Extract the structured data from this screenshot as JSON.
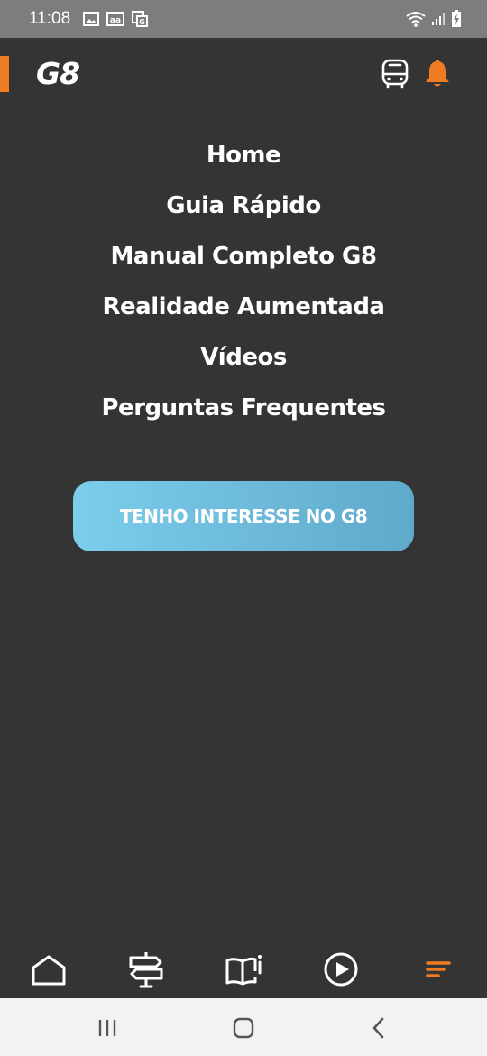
{
  "status_bar": {
    "time": "11:08",
    "left_icons": [
      "image-icon",
      "text-recognition-icon",
      "translate-icon"
    ],
    "right_icons": [
      "wifi-icon",
      "signal-icon",
      "battery-charging-icon"
    ]
  },
  "header": {
    "logo_text": "G8",
    "icons": [
      "bus-icon",
      "bell-icon"
    ]
  },
  "menu": {
    "items": [
      {
        "label": "Home"
      },
      {
        "label": "Guia Rápido"
      },
      {
        "label": "Manual Completo G8"
      },
      {
        "label": "Realidade Aumentada"
      },
      {
        "label": "Vídeos"
      },
      {
        "label": "Perguntas Frequentes"
      }
    ]
  },
  "cta": {
    "label": "TENHO INTERESSE NO G8"
  },
  "tab_bar": {
    "tabs": [
      {
        "icon": "home-icon"
      },
      {
        "icon": "signpost-icon"
      },
      {
        "icon": "book-icon"
      },
      {
        "icon": "play-circle-icon"
      },
      {
        "icon": "menu-icon",
        "active": true
      }
    ]
  },
  "system_nav": {
    "buttons": [
      "recent-apps-icon",
      "home-circle-icon",
      "back-icon"
    ]
  },
  "colors": {
    "background": "#343434",
    "accent": "#ef7b22",
    "cta_gradient_start": "#7ccdec",
    "cta_gradient_end": "#5fa9cb",
    "status_bar": "#7d7d7d",
    "system_nav": "#f2f2f2"
  }
}
